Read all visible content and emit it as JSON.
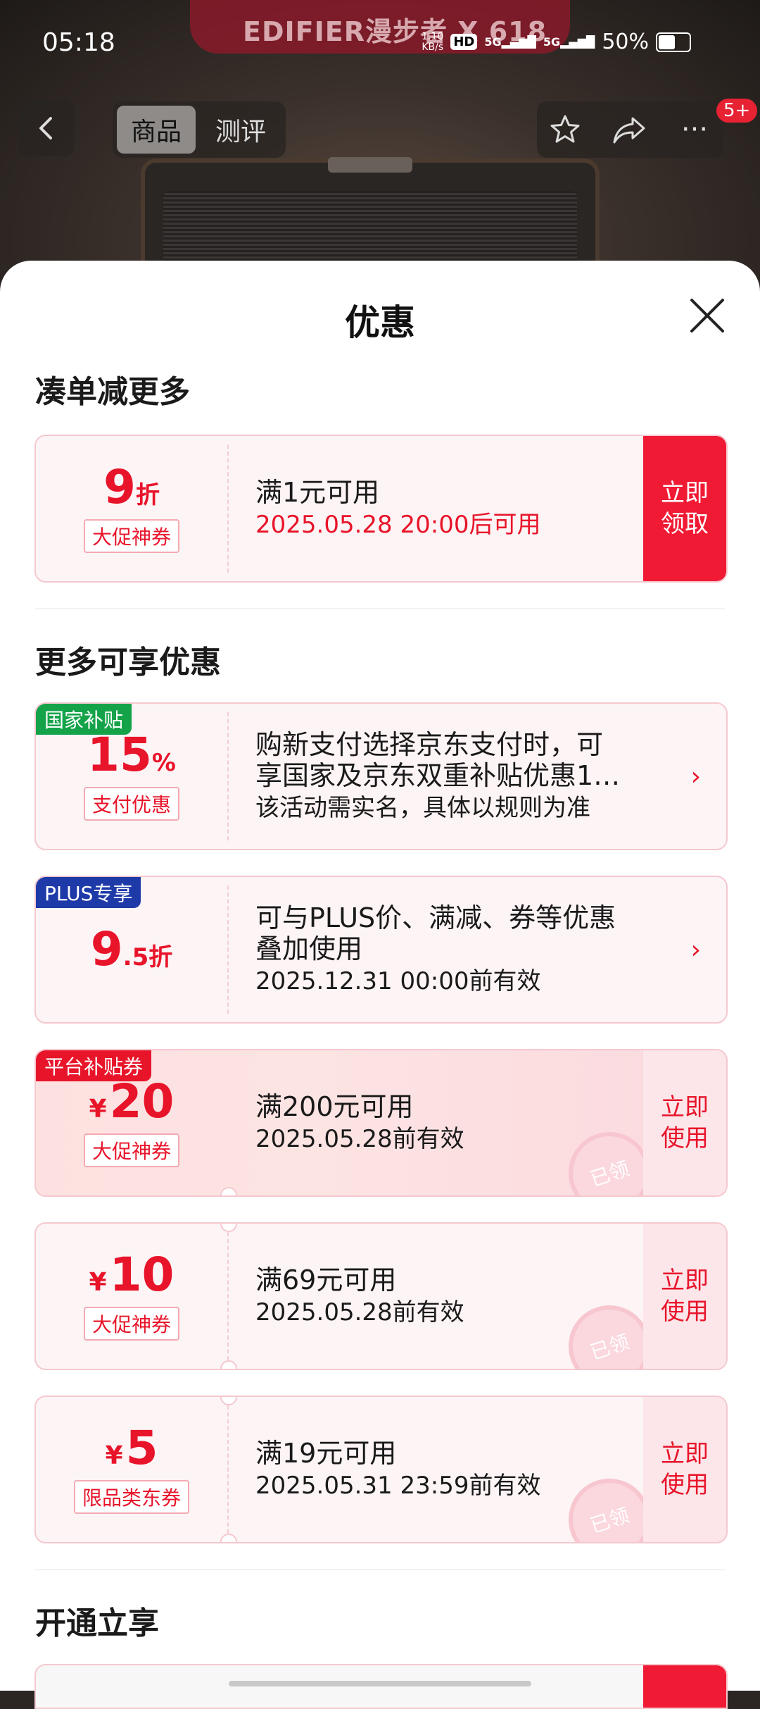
{
  "status_bar": {
    "time": "05:18",
    "net_speed_value": "1.10",
    "net_speed_unit": "KB/s",
    "hd_label": "HD",
    "sim1": "5G",
    "sim2": "5G",
    "battery": "50%"
  },
  "background": {
    "brand_text": "EDIFIER漫步者 X 618"
  },
  "nav": {
    "tabs": [
      {
        "label": "商品",
        "active": true
      },
      {
        "label": "测评",
        "active": false
      }
    ],
    "badge": "5+"
  },
  "sheet": {
    "title": "优惠",
    "section1_title": "凑单减更多",
    "section2_title": "更多可享优惠",
    "section3_title": "开通立享"
  },
  "coupons": [
    {
      "value": "9",
      "unit": "折",
      "tag": "大促神券",
      "line1": "满1元可用",
      "line2": "2025.05.28 20:00后可用",
      "action": "立即领取"
    },
    {
      "label": "国家补贴",
      "value": "15",
      "unit": "%",
      "tag": "支付优惠",
      "line1": "购新支付选择京东支付时，可",
      "line2": "享国家及京东双重补贴优惠1…",
      "line3": "该活动需实名，具体以规则为准"
    },
    {
      "label": "PLUS专享",
      "value": "9",
      "unit": ".5折",
      "line1": "可与PLUS价、满减、券等优惠",
      "line2": "叠加使用",
      "line3": "2025.12.31 00:00前有效"
    },
    {
      "label": "平台补贴券",
      "currency": "¥",
      "value": "20",
      "tag": "大促神券",
      "line1": "满200元可用",
      "line2": "2025.05.28前有效",
      "action": "立即使用",
      "stamp": "已领"
    },
    {
      "currency": "¥",
      "value": "10",
      "tag": "大促神券",
      "line1": "满69元可用",
      "line2": "2025.05.28前有效",
      "action": "立即使用",
      "stamp": "已领"
    },
    {
      "currency": "¥",
      "value": "5",
      "tag": "限品类东券",
      "line1": "满19元可用",
      "line2": "2025.05.31 23:59前有效",
      "action": "立即使用",
      "stamp": "已领"
    }
  ],
  "colors": {
    "accent_red": "#e8142a",
    "claim_button": "#f01a34",
    "green_label": "#15a34a",
    "blue_label": "#1e3aa8"
  }
}
